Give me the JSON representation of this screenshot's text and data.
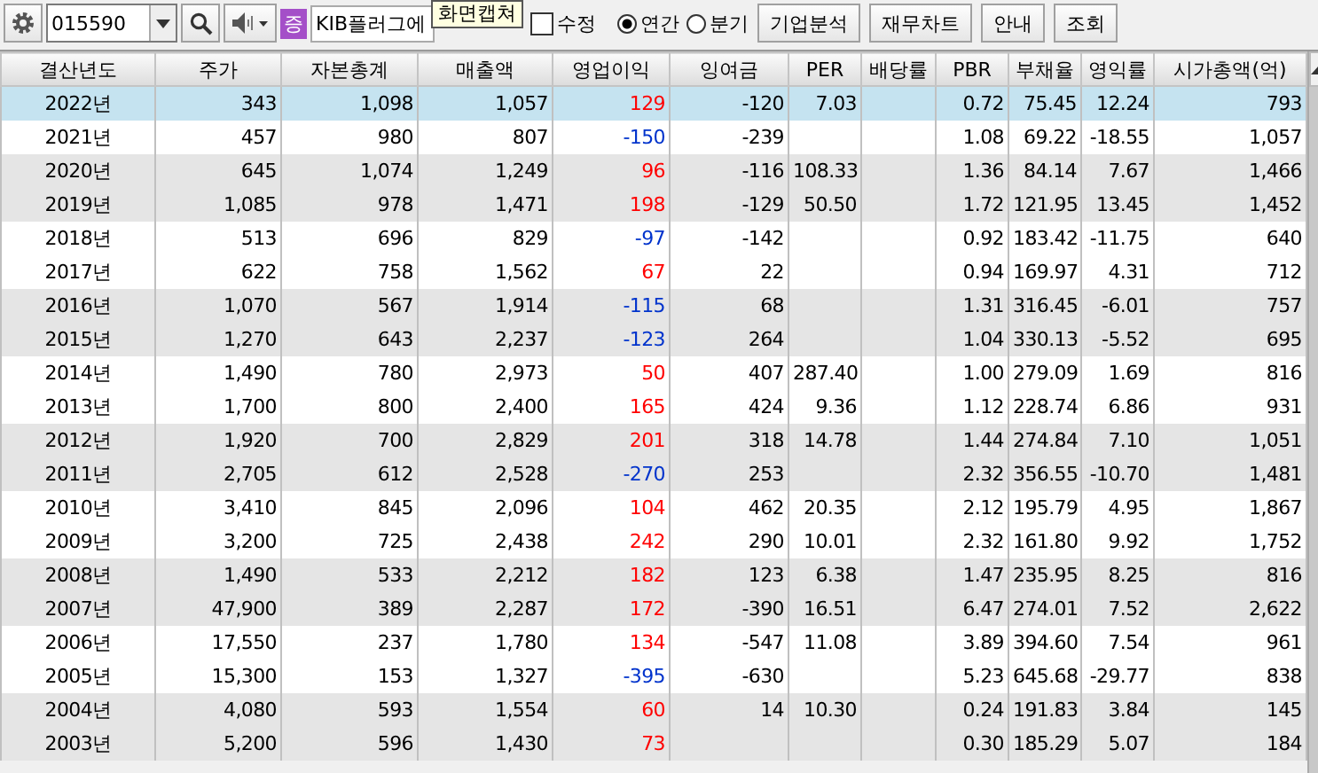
{
  "toolbar": {
    "code": "015590",
    "badge": "증",
    "company": "KIB플러그에",
    "tooltip": "화면캡쳐",
    "adjust": {
      "label": "수정",
      "checked": false
    },
    "period": [
      {
        "label": "연간",
        "selected": true
      },
      {
        "label": "분기",
        "selected": false
      }
    ],
    "buttons": [
      "기업분석",
      "재무차트",
      "안내",
      "조회"
    ]
  },
  "table": {
    "columns": [
      "결산년도",
      "주가",
      "자본총계",
      "매출액",
      "영업이익",
      "잉여금",
      "PER",
      "배당률",
      "PBR",
      "부채율",
      "영익률",
      "시가총액(억)"
    ],
    "rows": [
      {
        "selected": true,
        "cells": [
          "2022년",
          "343",
          "1,098",
          "1,057",
          "129",
          "-120",
          "7.03",
          "",
          "0.72",
          "75.45",
          "12.24",
          "793"
        ],
        "color": "#ff0000"
      },
      {
        "selected": false,
        "cells": [
          "2021년",
          "457",
          "980",
          "807",
          "-150",
          "-239",
          "",
          "",
          "1.08",
          "69.22",
          "-18.55",
          "1,057"
        ],
        "color": "#0033cc"
      },
      {
        "selected": false,
        "cells": [
          "2020년",
          "645",
          "1,074",
          "1,249",
          "96",
          "-116",
          "108.33",
          "",
          "1.36",
          "84.14",
          "7.67",
          "1,466"
        ],
        "color": "#ff0000"
      },
      {
        "selected": false,
        "cells": [
          "2019년",
          "1,085",
          "978",
          "1,471",
          "198",
          "-129",
          "50.50",
          "",
          "1.72",
          "121.95",
          "13.45",
          "1,452"
        ],
        "color": "#ff0000"
      },
      {
        "selected": false,
        "cells": [
          "2018년",
          "513",
          "696",
          "829",
          "-97",
          "-142",
          "",
          "",
          "0.92",
          "183.42",
          "-11.75",
          "640"
        ],
        "color": "#0033cc"
      },
      {
        "selected": false,
        "cells": [
          "2017년",
          "622",
          "758",
          "1,562",
          "67",
          "22",
          "",
          "",
          "0.94",
          "169.97",
          "4.31",
          "712"
        ],
        "color": "#ff0000"
      },
      {
        "selected": false,
        "cells": [
          "2016년",
          "1,070",
          "567",
          "1,914",
          "-115",
          "68",
          "",
          "",
          "1.31",
          "316.45",
          "-6.01",
          "757"
        ],
        "color": "#0033cc"
      },
      {
        "selected": false,
        "cells": [
          "2015년",
          "1,270",
          "643",
          "2,237",
          "-123",
          "264",
          "",
          "",
          "1.04",
          "330.13",
          "-5.52",
          "695"
        ],
        "color": "#0033cc"
      },
      {
        "selected": false,
        "cells": [
          "2014년",
          "1,490",
          "780",
          "2,973",
          "50",
          "407",
          "287.40",
          "",
          "1.00",
          "279.09",
          "1.69",
          "816"
        ],
        "color": "#ff0000"
      },
      {
        "selected": false,
        "cells": [
          "2013년",
          "1,700",
          "800",
          "2,400",
          "165",
          "424",
          "9.36",
          "",
          "1.12",
          "228.74",
          "6.86",
          "931"
        ],
        "color": "#ff0000"
      },
      {
        "selected": false,
        "cells": [
          "2012년",
          "1,920",
          "700",
          "2,829",
          "201",
          "318",
          "14.78",
          "",
          "1.44",
          "274.84",
          "7.10",
          "1,051"
        ],
        "color": "#ff0000"
      },
      {
        "selected": false,
        "cells": [
          "2011년",
          "2,705",
          "612",
          "2,528",
          "-270",
          "253",
          "",
          "",
          "2.32",
          "356.55",
          "-10.70",
          "1,481"
        ],
        "color": "#0033cc"
      },
      {
        "selected": false,
        "cells": [
          "2010년",
          "3,410",
          "845",
          "2,096",
          "104",
          "462",
          "20.35",
          "",
          "2.12",
          "195.79",
          "4.95",
          "1,867"
        ],
        "color": "#ff0000"
      },
      {
        "selected": false,
        "cells": [
          "2009년",
          "3,200",
          "725",
          "2,438",
          "242",
          "290",
          "10.01",
          "",
          "2.32",
          "161.80",
          "9.92",
          "1,752"
        ],
        "color": "#ff0000"
      },
      {
        "selected": false,
        "cells": [
          "2008년",
          "1,490",
          "533",
          "2,212",
          "182",
          "123",
          "6.38",
          "",
          "1.47",
          "235.95",
          "8.25",
          "816"
        ],
        "color": "#ff0000"
      },
      {
        "selected": false,
        "cells": [
          "2007년",
          "47,900",
          "389",
          "2,287",
          "172",
          "-390",
          "16.51",
          "",
          "6.47",
          "274.01",
          "7.52",
          "2,622"
        ],
        "color": "#ff0000"
      },
      {
        "selected": false,
        "cells": [
          "2006년",
          "17,550",
          "237",
          "1,780",
          "134",
          "-547",
          "11.08",
          "",
          "3.89",
          "394.60",
          "7.54",
          "961"
        ],
        "color": "#ff0000"
      },
      {
        "selected": false,
        "cells": [
          "2005년",
          "15,300",
          "153",
          "1,327",
          "-395",
          "-630",
          "",
          "",
          "5.23",
          "645.68",
          "-29.77",
          "838"
        ],
        "color": "#0033cc"
      },
      {
        "selected": false,
        "cells": [
          "2004년",
          "4,080",
          "593",
          "1,554",
          "60",
          "14",
          "10.30",
          "",
          "0.24",
          "191.83",
          "3.84",
          "145"
        ],
        "color": "#ff0000"
      },
      {
        "selected": false,
        "cells": [
          "2003년",
          "5,200",
          "596",
          "1,430",
          "73",
          "",
          "",
          "",
          "0.30",
          "185.29",
          "5.07",
          "184"
        ],
        "color": "#ff0000"
      }
    ]
  }
}
